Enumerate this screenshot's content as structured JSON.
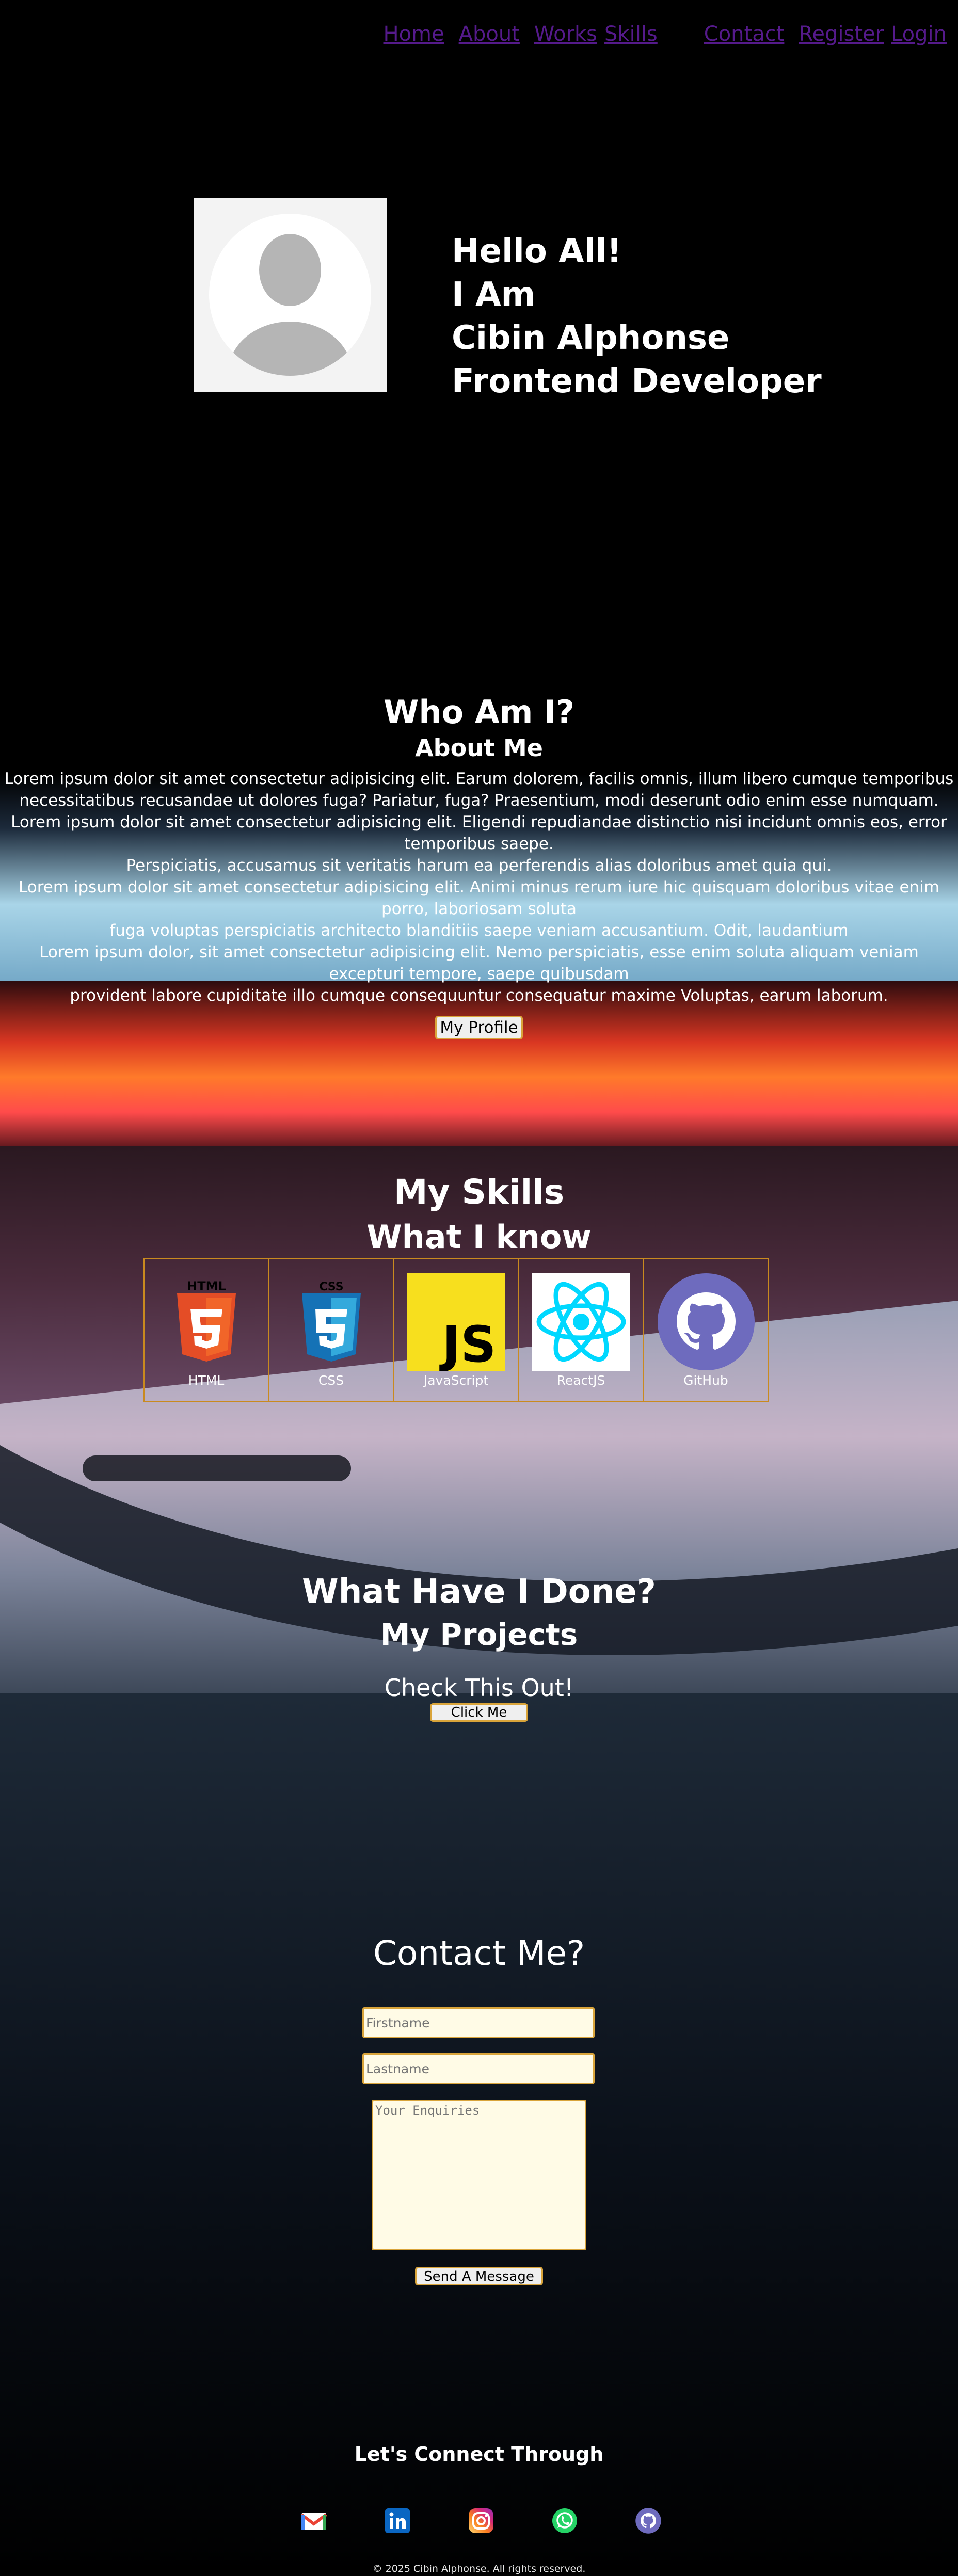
{
  "nav": {
    "items": [
      "Home",
      "About",
      "Works",
      "Skills",
      "Contact",
      "Register",
      "Login"
    ]
  },
  "hero": {
    "line1": "Hello All!",
    "line2": "I Am",
    "line3": "Cibin Alphonse",
    "line4": "Frontend Developer"
  },
  "about": {
    "title": "Who Am I?",
    "subtitle": "About Me",
    "paragraphs": [
      "Lorem ipsum dolor sit amet consectetur adipisicing elit. Earum dolorem, facilis omnis, illum libero cumque temporibus necessitatibus recusandae ut dolores fuga? Pariatur, fuga? Praesentium, modi deserunt odio enim esse numquam.",
      "Lorem ipsum dolor sit amet consectetur adipisicing elit. Eligendi repudiandae distinctio nisi incidunt omnis eos, error temporibus saepe.",
      "Perspiciatis, accusamus sit veritatis harum ea perferendis alias doloribus amet quia qui.",
      "Lorem ipsum dolor sit amet consectetur adipisicing elit. Animi minus rerum iure hic quisquam doloribus vitae enim porro, laboriosam soluta",
      "fuga voluptas perspiciatis architecto blanditiis saepe veniam accusantium. Odit, laudantium",
      "Lorem ipsum dolor, sit amet consectetur adipisicing elit. Nemo perspiciatis, esse enim soluta aliquam veniam excepturi tempore, saepe quibusdam",
      "provident labore cupiditate illo cumque consequuntur consequatur maxime Voluptas, earum laborum."
    ],
    "button": "My Profile"
  },
  "skills": {
    "title": "My Skills",
    "subtitle": "What I know",
    "items": [
      {
        "label": "HTML",
        "icon": "html5-icon",
        "badge": "5",
        "color": "#E44D26"
      },
      {
        "label": "CSS",
        "icon": "css3-icon",
        "badge": "3",
        "color": "#1572B6"
      },
      {
        "label": "JavaScript",
        "icon": "javascript-icon",
        "badge": "JS",
        "color": "#F7DF1E"
      },
      {
        "label": "ReactJS",
        "icon": "react-icon",
        "color": "#00D8FF"
      },
      {
        "label": "GitHub",
        "icon": "github-icon",
        "color": "#6E6BBE"
      }
    ]
  },
  "projects": {
    "title": "What Have I Done?",
    "subtitle": "My Projects",
    "cta": "Check This Out!",
    "button": "Click Me"
  },
  "contact": {
    "title": "Contact Me?",
    "firstname_placeholder": "Firstname",
    "lastname_placeholder": "Lastname",
    "enquiry_placeholder": "Your Enquiries",
    "button": "Send A Message"
  },
  "footer": {
    "connect_title": "Let's Connect Through",
    "socials": [
      {
        "name": "gmail-icon",
        "color": "#EA4335"
      },
      {
        "name": "linkedin-icon",
        "color": "#0A66C2"
      },
      {
        "name": "instagram-icon",
        "color": "#E1306C"
      },
      {
        "name": "whatsapp-icon",
        "color": "#25D366"
      },
      {
        "name": "github-icon",
        "color": "#6E6BBE"
      }
    ],
    "copyright": "© 2025 Cibin Alphonse. All rights reserved."
  }
}
